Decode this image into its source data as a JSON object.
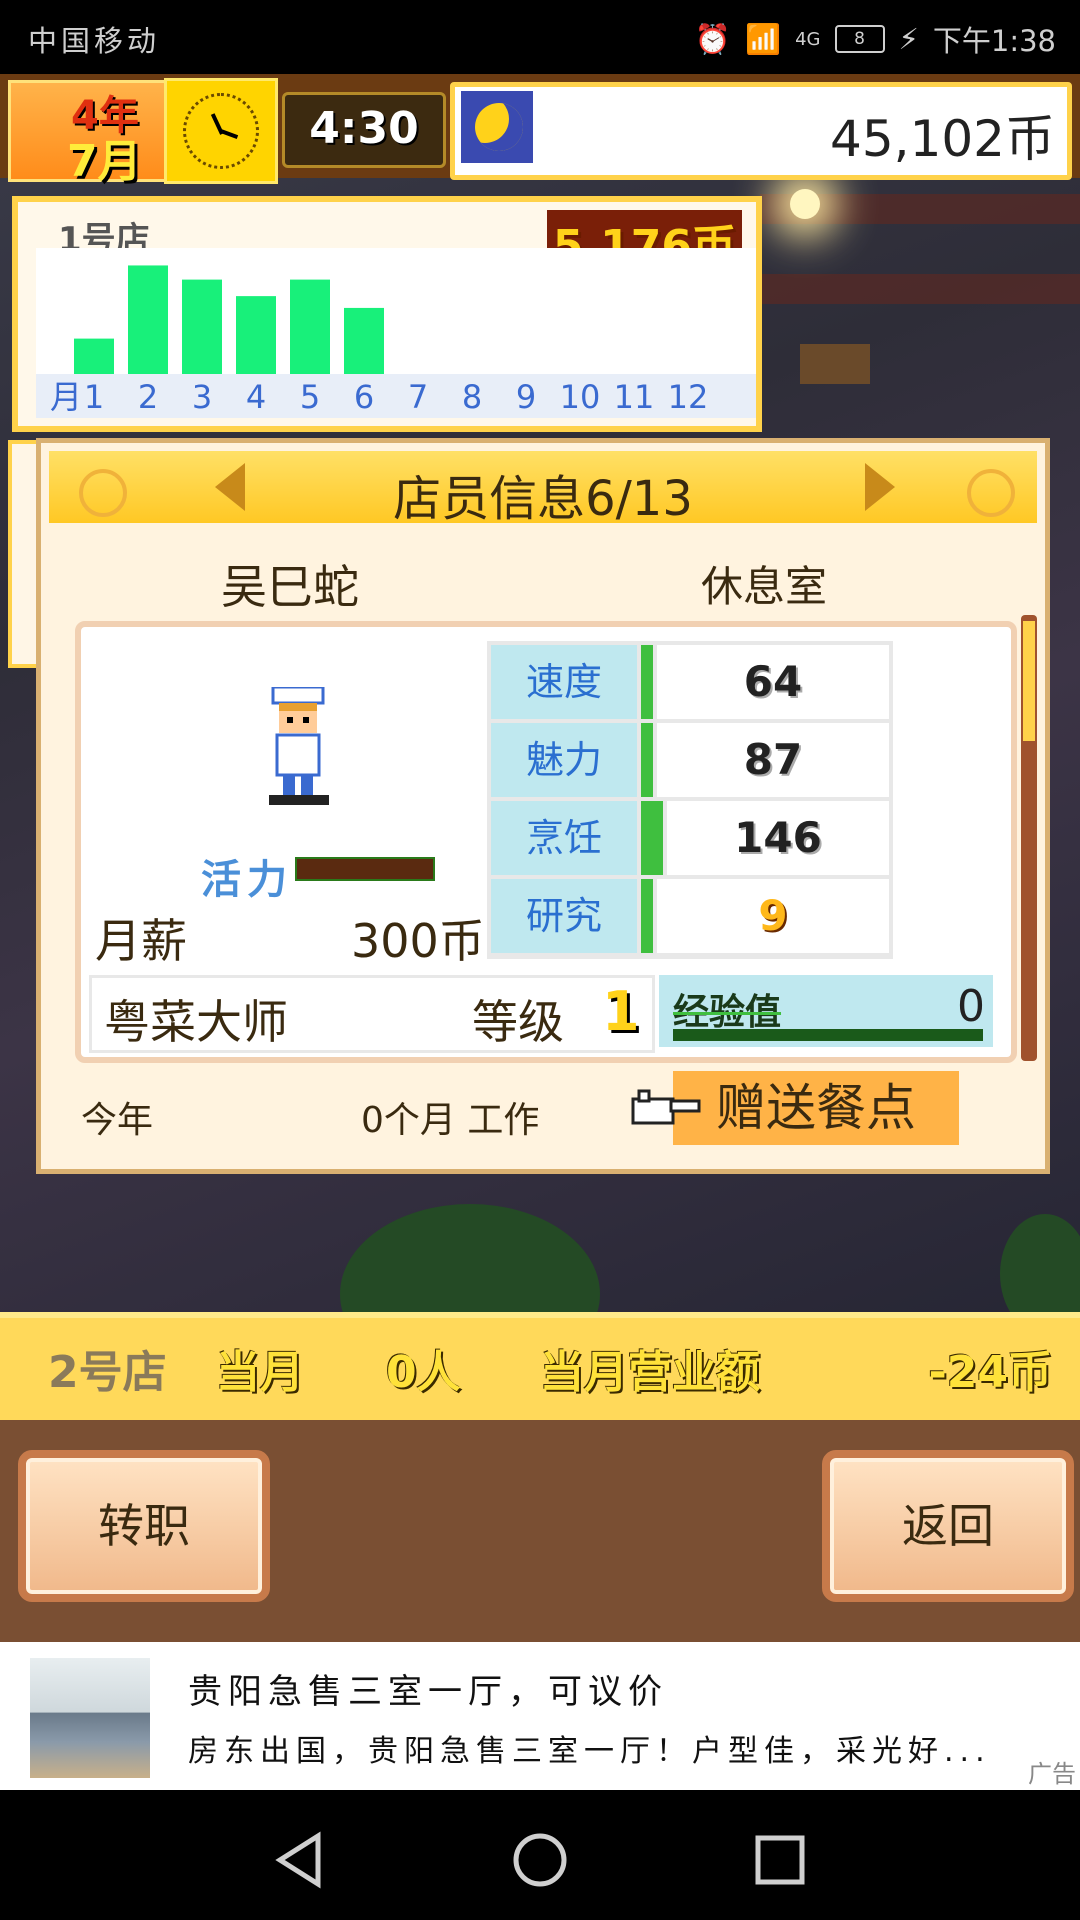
{
  "status_bar": {
    "carrier": "中国移动",
    "network": "4G",
    "battery": "8",
    "time": "下午1:38"
  },
  "top_bar": {
    "year": "4年",
    "month": "7月",
    "time": "4:30",
    "money": "45,102币"
  },
  "shop1": {
    "name": "1号店",
    "total": "5,176币",
    "month_label": "月",
    "months": [
      "1",
      "2",
      "3",
      "4",
      "5",
      "6",
      "7",
      "8",
      "9",
      "10",
      "11",
      "12"
    ],
    "chart_data": {
      "type": "bar",
      "categories": [
        "1",
        "2",
        "3",
        "4",
        "5",
        "6",
        "7",
        "8",
        "9",
        "10",
        "11",
        "12"
      ],
      "values": [
        30,
        92,
        80,
        66,
        80,
        56,
        0,
        0,
        0,
        0,
        0,
        0
      ]
    }
  },
  "dialog": {
    "title": "店员信息6/13",
    "employee_name": "吴巳蛇",
    "location": "休息室",
    "vitality_label": "活力",
    "vitality_level": 1.0,
    "salary_label": "月薪",
    "salary_value": "300币",
    "stats": [
      {
        "label": "速度",
        "value": "64"
      },
      {
        "label": "魅力",
        "value": "87"
      },
      {
        "label": "烹饪",
        "value": "146"
      },
      {
        "label": "研究",
        "value": "9"
      }
    ],
    "job_title": "粤菜大师",
    "level_label": "等级",
    "level_value": "1",
    "exp_label": "经验值",
    "exp_value": "0",
    "this_year_label": "今年",
    "worked_label": "0个月 工作",
    "gift_button": "赠送餐点"
  },
  "shop2": {
    "name": "2号店",
    "month_label": "当月",
    "customers": "0人",
    "revenue_label": "当月营业额",
    "revenue_value": "-24币"
  },
  "buttons": {
    "transfer": "转职",
    "back": "返回"
  },
  "ad": {
    "title": "贵阳急售三室一厅，可议价",
    "desc": "房东出国，贵阳急售三室一厅！户型佳，采光好...",
    "tag": "广告"
  }
}
